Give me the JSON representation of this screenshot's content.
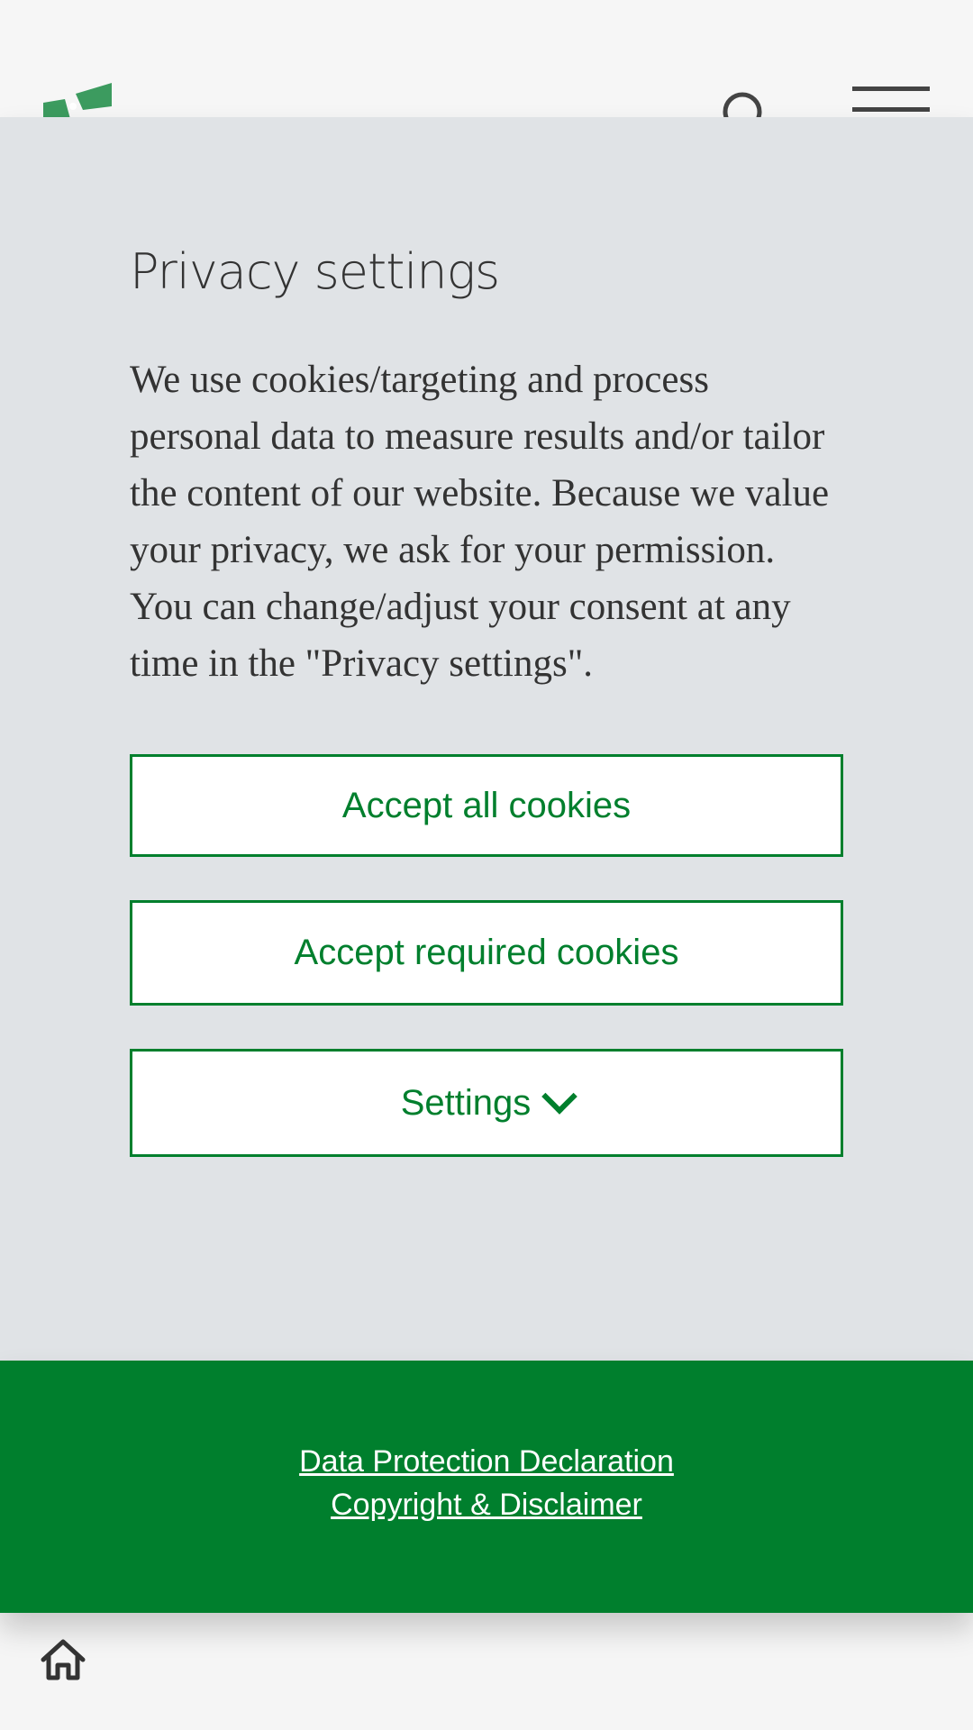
{
  "modal": {
    "title": "Privacy settings",
    "description": "We use cookies/targeting and process personal data to measure results and/or tailor the content of our website. Because we value your privacy, we ask for your permission. You can change/adjust your consent at any time in the \"Privacy settings\".",
    "buttons": {
      "accept_all": "Accept all cookies",
      "accept_required": "Accept required cookies",
      "settings": "Settings"
    }
  },
  "footer": {
    "links": [
      "Data Protection Declaration",
      "Copyright & Disclaimer"
    ]
  },
  "colors": {
    "brand_green": "#007f2d",
    "modal_bg": "#e0e3e6",
    "text": "#333333"
  },
  "icons": {
    "logo": "brand-logo",
    "search": "search-icon",
    "menu": "hamburger-menu-icon",
    "chevron": "chevron-down-icon",
    "home": "home-icon"
  }
}
